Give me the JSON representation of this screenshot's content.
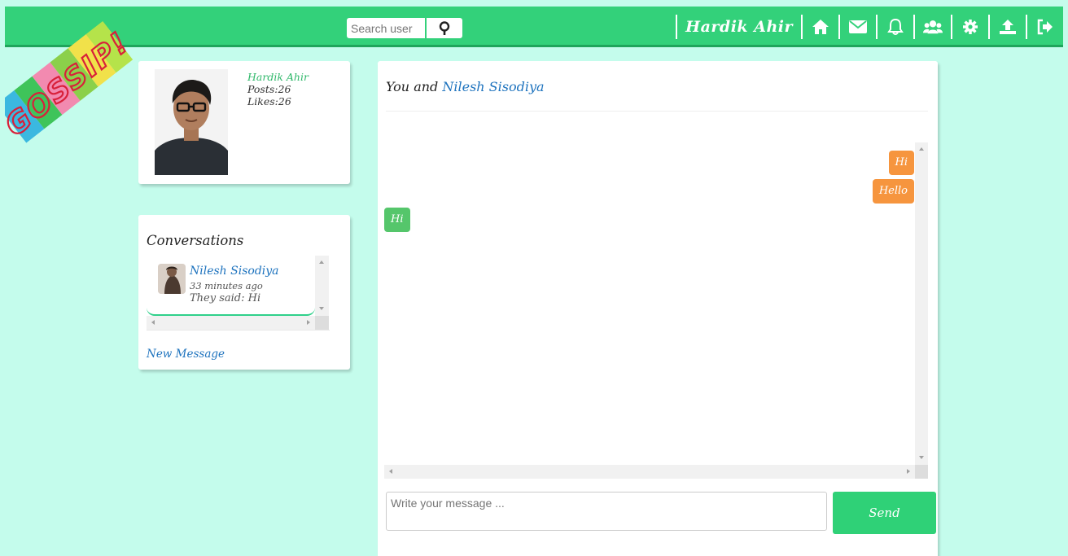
{
  "app": {
    "logo_text": "GOSSIP!"
  },
  "header": {
    "search_placeholder": "Search user",
    "username": "Hardik Ahir",
    "icons": [
      "home-icon",
      "mail-icon",
      "bell-icon",
      "users-icon",
      "gear-icon",
      "upload-icon",
      "logout-icon"
    ]
  },
  "profile": {
    "name": "Hardik Ahir",
    "posts": "Posts:26",
    "likes": "Likes:26"
  },
  "conversations": {
    "title": "Conversations",
    "items": [
      {
        "name": "Nilesh Sisodiya",
        "time": "33 minutes ago",
        "last": "They said: Hi"
      }
    ],
    "new_message": "New Message"
  },
  "chat": {
    "prefix": "You and",
    "partner": "Nilesh Sisodiya",
    "messages": [
      {
        "from": "me",
        "text": "Hi"
      },
      {
        "from": "me",
        "text": "Hello"
      },
      {
        "from": "them",
        "text": "Hi"
      }
    ],
    "input_placeholder": "Write your message ...",
    "send_label": "Send"
  },
  "colors": {
    "page_bg": "#c4fcec",
    "header_bg": "#33d17a",
    "my_bubble": "#f6953e",
    "their_bubble": "#55c66b",
    "link": "#1e73be"
  }
}
